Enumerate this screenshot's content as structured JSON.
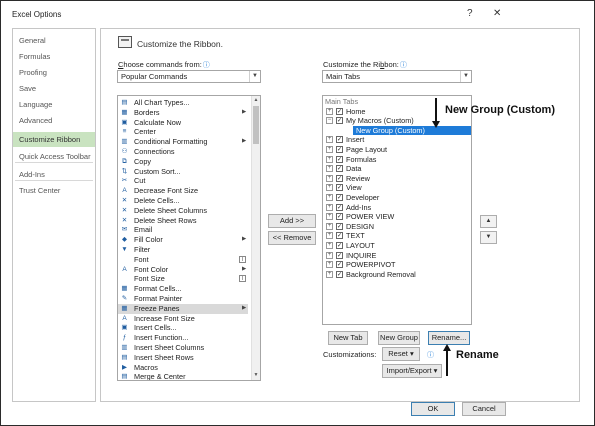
{
  "window": {
    "title": "Excel Options",
    "help": "?",
    "close": "✕"
  },
  "nav": {
    "items": [
      {
        "label": "General"
      },
      {
        "label": "Formulas"
      },
      {
        "label": "Proofing"
      },
      {
        "label": "Save"
      },
      {
        "label": "Language"
      },
      {
        "label": "Advanced"
      },
      {
        "label": "Customize Ribbon"
      },
      {
        "label": "Quick Access Toolbar"
      },
      {
        "label": "Add-Ins"
      },
      {
        "label": "Trust Center"
      }
    ],
    "selected": "Customize Ribbon"
  },
  "header": {
    "title": "Customize the Ribbon."
  },
  "left_panel": {
    "label_prefix": "",
    "label_underlined": "C",
    "label_rest": "hoose commands from:",
    "info_icon": "ⓘ",
    "combo_value": "Popular Commands",
    "commands": [
      {
        "label": "All Chart Types...",
        "icon": "▤",
        "flag": ""
      },
      {
        "label": "Borders",
        "icon": "▦",
        "flag": "▶"
      },
      {
        "label": "Calculate Now",
        "icon": "▣",
        "flag": ""
      },
      {
        "label": "Center",
        "icon": "≡",
        "flag": ""
      },
      {
        "label": "Conditional Formatting",
        "icon": "▥",
        "flag": "▶"
      },
      {
        "label": "Connections",
        "icon": "⚇",
        "flag": ""
      },
      {
        "label": "Copy",
        "icon": "⧉",
        "flag": ""
      },
      {
        "label": "Custom Sort...",
        "icon": "⇅",
        "flag": ""
      },
      {
        "label": "Cut",
        "icon": "✂",
        "flag": ""
      },
      {
        "label": "Decrease Font Size",
        "icon": "A",
        "flag": ""
      },
      {
        "label": "Delete Cells...",
        "icon": "✕",
        "flag": ""
      },
      {
        "label": "Delete Sheet Columns",
        "icon": "✕",
        "flag": ""
      },
      {
        "label": "Delete Sheet Rows",
        "icon": "✕",
        "flag": ""
      },
      {
        "label": "Email",
        "icon": "✉",
        "flag": ""
      },
      {
        "label": "Fill Color",
        "icon": "◆",
        "flag": "▶"
      },
      {
        "label": "Filter",
        "icon": "▼",
        "flag": ""
      },
      {
        "label": "Font",
        "icon": "",
        "flag": "I"
      },
      {
        "label": "Font Color",
        "icon": "A",
        "flag": "▶"
      },
      {
        "label": "Font Size",
        "icon": "",
        "flag": "I"
      },
      {
        "label": "Format Cells...",
        "icon": "▦",
        "flag": ""
      },
      {
        "label": "Format Painter",
        "icon": "✎",
        "flag": ""
      },
      {
        "label": "Freeze Panes",
        "icon": "▦",
        "flag": "▶"
      },
      {
        "label": "Increase Font Size",
        "icon": "A",
        "flag": ""
      },
      {
        "label": "Insert Cells...",
        "icon": "▣",
        "flag": ""
      },
      {
        "label": "Insert Function...",
        "icon": "ƒ",
        "flag": ""
      },
      {
        "label": "Insert Sheet Columns",
        "icon": "▥",
        "flag": ""
      },
      {
        "label": "Insert Sheet Rows",
        "icon": "▤",
        "flag": ""
      },
      {
        "label": "Macros",
        "icon": "▶",
        "flag": ""
      },
      {
        "label": "Merge & Center",
        "icon": "▤",
        "flag": ""
      }
    ],
    "selected_index": 21
  },
  "middle": {
    "add_label": "Add >>",
    "remove_label": "<< Remove"
  },
  "right_panel": {
    "label_prefix": "Customize the Ri",
    "label_underlined": "b",
    "label_rest": "bon:",
    "info_icon": "ⓘ",
    "combo_value": "Main Tabs",
    "tree_header": "Main Tabs",
    "tabs": [
      {
        "label": "Home",
        "expander": "⊞",
        "checked": true
      },
      {
        "label": "My Macros (Custom)",
        "expander": "⊟",
        "checked": true
      },
      {
        "label": "New Group (Custom)",
        "expander": "",
        "checked": false,
        "group": true
      },
      {
        "label": "Insert",
        "expander": "⊞",
        "checked": true
      },
      {
        "label": "Page Layout",
        "expander": "⊞",
        "checked": true
      },
      {
        "label": "Formulas",
        "expander": "⊞",
        "checked": true
      },
      {
        "label": "Data",
        "expander": "⊞",
        "checked": true
      },
      {
        "label": "Review",
        "expander": "⊞",
        "checked": true
      },
      {
        "label": "View",
        "expander": "⊞",
        "checked": true
      },
      {
        "label": "Developer",
        "expander": "⊞",
        "checked": true
      },
      {
        "label": "Add-Ins",
        "expander": "⊞",
        "checked": true
      },
      {
        "label": "POWER VIEW",
        "expander": "⊞",
        "checked": true
      },
      {
        "label": "DESIGN",
        "expander": "⊞",
        "checked": true
      },
      {
        "label": "TEXT",
        "expander": "⊞",
        "checked": true
      },
      {
        "label": "LAYOUT",
        "expander": "⊞",
        "checked": true
      },
      {
        "label": "INQUIRE",
        "expander": "⊞",
        "checked": true
      },
      {
        "label": "POWERPIVOT",
        "expander": "⊞",
        "checked": true
      },
      {
        "label": "Background Removal",
        "expander": "⊞",
        "checked": true
      }
    ],
    "new_tab_label": "New Tab",
    "new_group_label": "New Group",
    "rename_label": "Rename...",
    "customizations_label": "Customizations:",
    "reset_label": "Reset ▾",
    "import_export_label": "Import/Export ▾",
    "move_up": "▲",
    "move_down": "▼"
  },
  "annotations": {
    "new_group": "New Group (Custom)",
    "rename": "Rename"
  },
  "footer": {
    "ok_label": "OK",
    "cancel_label": "Cancel"
  }
}
